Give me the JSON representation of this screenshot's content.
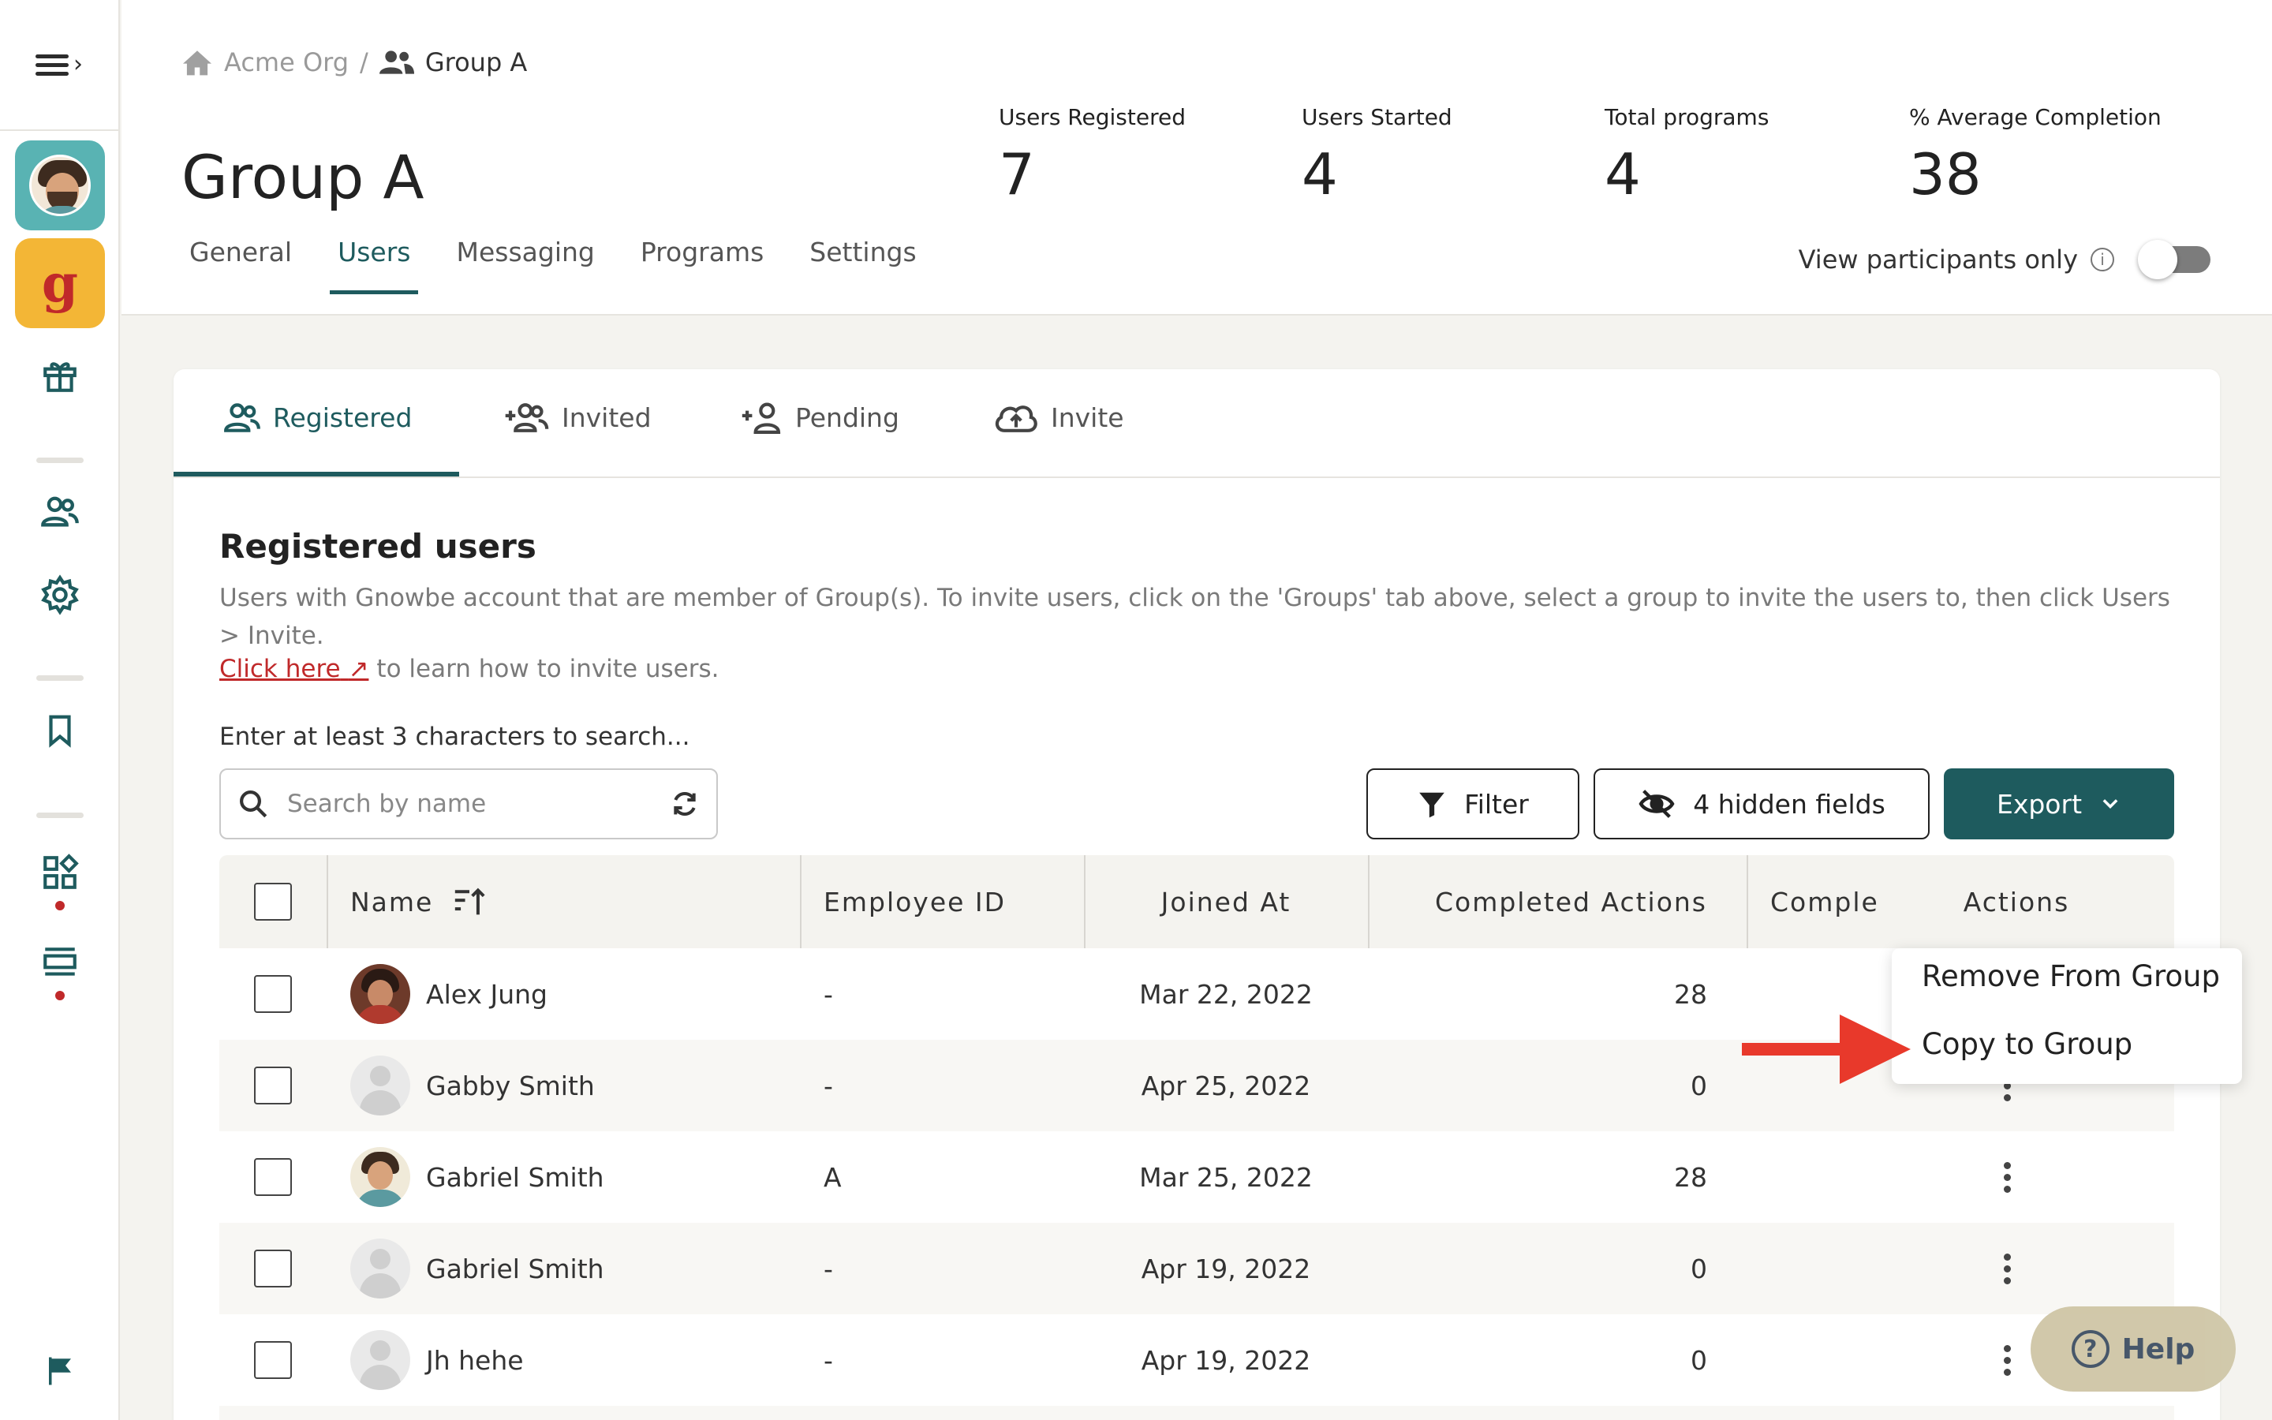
{
  "breadcrumb": {
    "org": "Acme Org",
    "separator": "/",
    "group": "Group A"
  },
  "page": {
    "title": "Group A"
  },
  "stats": [
    {
      "label": "Users Registered",
      "value": "7"
    },
    {
      "label": "Users Started",
      "value": "4"
    },
    {
      "label": "Total programs",
      "value": "4"
    },
    {
      "label": "% Average Completion",
      "value": "38"
    }
  ],
  "tabs": [
    "General",
    "Users",
    "Messaging",
    "Programs",
    "Settings"
  ],
  "active_tab": "Users",
  "view_participants": {
    "label": "View participants only",
    "enabled": false
  },
  "sidebar": {
    "org_letter": "g",
    "icons": [
      "menu-icon",
      "gift-icon",
      "users-icon",
      "settings-icon",
      "bookmark-icon",
      "widgets-icon",
      "list-icon",
      "flag-icon"
    ]
  },
  "subtabs": [
    "Registered",
    "Invited",
    "Pending",
    "Invite"
  ],
  "active_subtab": "Registered",
  "section": {
    "title": "Registered users",
    "description": "Users with Gnowbe account that are member of Group(s). To invite users, click on the 'Groups' tab above, select a group to invite the users to, then click Users > Invite.",
    "link_text": "Click here",
    "link_suffix": "to learn how to invite users."
  },
  "search": {
    "label": "Enter at least 3 characters to search...",
    "placeholder": "Search by name"
  },
  "buttons": {
    "filter": "Filter",
    "hidden_fields": "4 hidden fields",
    "export": "Export"
  },
  "table": {
    "columns": [
      "Name",
      "Employee ID",
      "Joined At",
      "Completed Actions",
      "Comple",
      "Actions"
    ],
    "rows": [
      {
        "name": "Alex Jung",
        "employee_id": "-",
        "joined_at": "Mar 22, 2022",
        "completed_actions": "28"
      },
      {
        "name": "Gabby Smith",
        "employee_id": "-",
        "joined_at": "Apr 25, 2022",
        "completed_actions": "0"
      },
      {
        "name": "Gabriel Smith",
        "employee_id": "A",
        "joined_at": "Mar 25, 2022",
        "completed_actions": "28"
      },
      {
        "name": "Gabriel Smith",
        "employee_id": "-",
        "joined_at": "Apr 19, 2022",
        "completed_actions": "0"
      },
      {
        "name": "Jh hehe",
        "employee_id": "-",
        "joined_at": "Apr 19, 2022",
        "completed_actions": "0"
      }
    ]
  },
  "row_menu": {
    "items": [
      "Remove From Group",
      "Copy to Group"
    ]
  },
  "help": {
    "label": "Help"
  },
  "colors": {
    "brand_teal": "#1e5b5e",
    "accent_red": "#c0292a",
    "annotation_arrow": "#e8392b",
    "org_yellow": "#f3b636",
    "user_teal": "#59b3b3"
  }
}
